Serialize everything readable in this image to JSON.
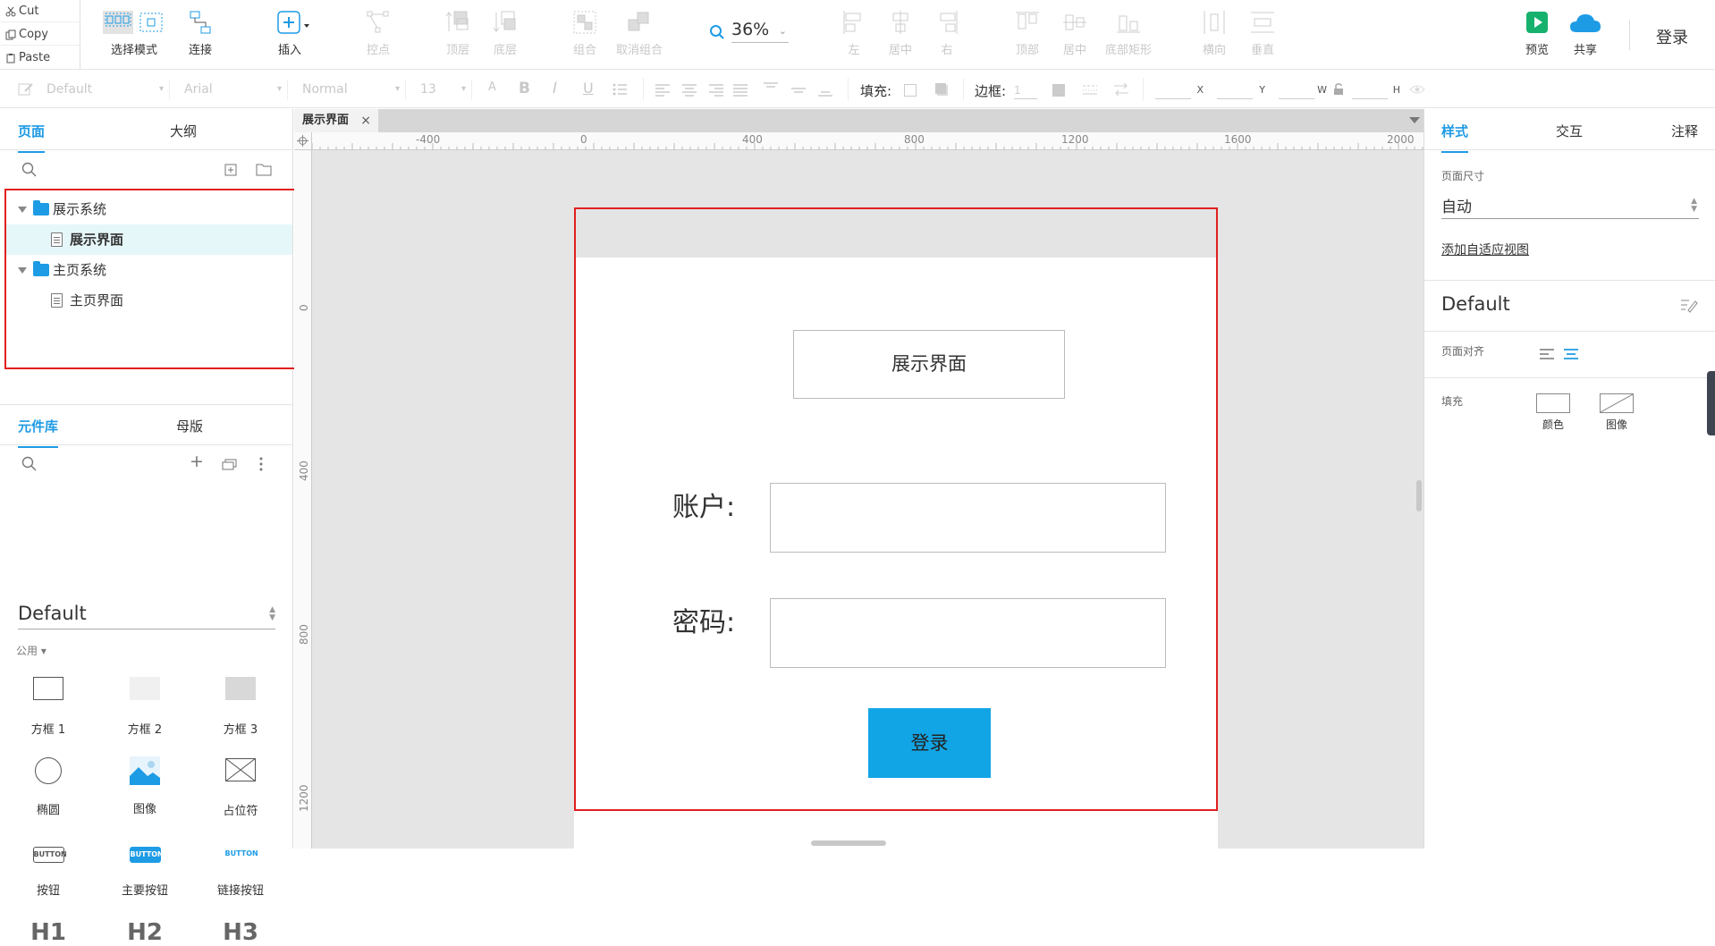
{
  "clipboard": {
    "cut": "Cut",
    "copy": "Copy",
    "paste": "Paste"
  },
  "toolbar": {
    "select_mode": "选择模式",
    "connect": "连接",
    "insert": "插入",
    "anchor": "控点",
    "top_layer": "顶层",
    "bottom_layer": "底层",
    "group": "组合",
    "ungroup": "取消组合",
    "zoom": "36%",
    "align_left": "左",
    "align_center": "居中",
    "align_right": "右",
    "align_top": "顶部",
    "align_middle": "居中",
    "align_bottom": "底部矩形",
    "dist_horizontal": "横向",
    "dist_vertical": "垂直",
    "preview": "预览",
    "share": "共享",
    "login": "登录"
  },
  "formatbar": {
    "style": "Default",
    "font": "Arial",
    "weight": "Normal",
    "size": "13",
    "fill_label": "填充:",
    "border_label": "边框:",
    "border_value": "1",
    "x_label": "X",
    "y_label": "Y",
    "w_label": "W",
    "h_label": "H"
  },
  "leftpanel": {
    "tabs": [
      "页面",
      "大纲"
    ],
    "pages": [
      {
        "label": "展示系统",
        "type": "folder"
      },
      {
        "label": "展示界面",
        "type": "page",
        "selected": true
      },
      {
        "label": "主页系统",
        "type": "folder"
      },
      {
        "label": "主页界面",
        "type": "page"
      }
    ],
    "lib_tabs": [
      "元件库",
      "母版"
    ],
    "library": "Default",
    "group": "公用 ▾",
    "widgets": [
      "方框 1",
      "方框 2",
      "方框 3",
      "椭圆",
      "图像",
      "占位符",
      "按钮",
      "主要按钮",
      "链接按钮",
      "H1",
      "H2",
      "H3"
    ],
    "button_text": "BUTTON"
  },
  "canvas": {
    "doc_tab": "展示界面",
    "ruler_h": [
      "-400",
      "0",
      "400",
      "800",
      "1200",
      "1600",
      "2000"
    ],
    "ruler_v": [
      "0",
      "400",
      "800",
      "1200"
    ],
    "title": "展示界面",
    "account_label": "账户:",
    "password_label": "密码:",
    "login_button": "登录"
  },
  "rightpanel": {
    "tabs": [
      "样式",
      "交互",
      "注释"
    ],
    "page_size_label": "页面尺寸",
    "page_size_value": "自动",
    "adaptive_link": "添加自适应视图",
    "style_name": "Default",
    "page_align_label": "页面对齐",
    "fill_label": "填充",
    "fill_color": "颜色",
    "fill_image": "图像"
  },
  "colors": {
    "accent": "#1e9be5",
    "highlight_box": "#e0201f",
    "login_button": "#12a5e5",
    "selected_row": "#e6f7fa"
  }
}
